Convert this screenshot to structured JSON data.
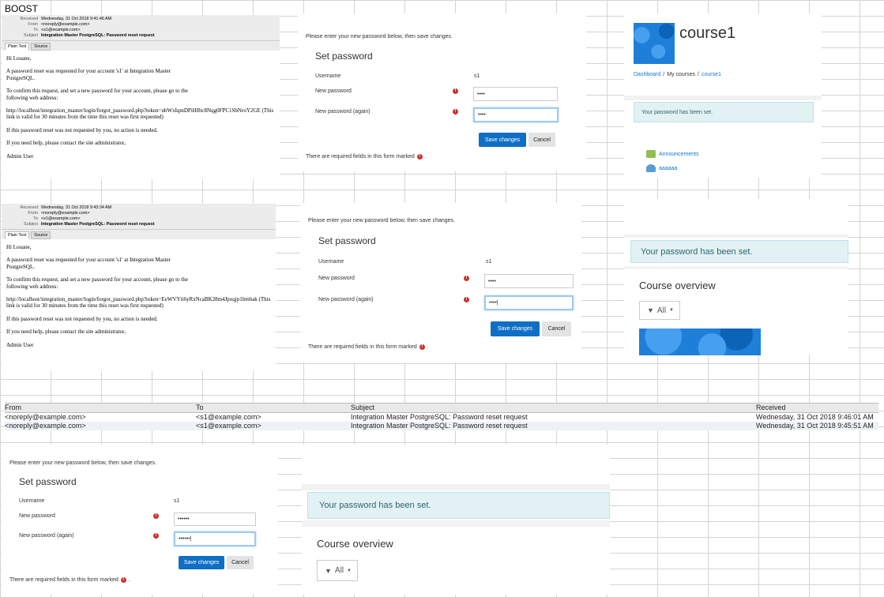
{
  "label": "BOOST",
  "email_fields": {
    "received": "Received",
    "from": "From",
    "to": "To",
    "subject": "Subject"
  },
  "email_tabs": [
    "Plain Text",
    "Source"
  ],
  "emails": [
    {
      "received": "Wednesday, 31 Oct 2018 9:41:46 AM",
      "from": "<noreply@example.com>",
      "to": "<s1@example.com>",
      "subject": "Integration Master PostgreSQL: Password reset request",
      "body": [
        "Hi Louane,",
        "A password reset was requested for your account 's1' at Integration Master PostgreSQL.",
        "To confirm this request, and set a new password for your account, please go to the following web address:",
        "http://localhost/integration_master/login/forgot_password.php?token=ubWxIqmDPiHRtc8Nqg0FPC1SbNroY2GE (This link is valid for 30 minutes from the time this reset was first requested)",
        "If this password reset was not requested by you, no action is needed.",
        "If you need help, please contact the site administrator,",
        "Admin User"
      ]
    },
    {
      "received": "Wednesday, 31 Oct 2018 9:43:34 AM",
      "from": "<noreply@example.com>",
      "to": "<s1@example.com>",
      "subject": "Integration Master PostgreSQL: Password reset request",
      "body": [
        "Hi Louane,",
        "A password reset was requested for your account 's1' at Integration Master PostgreSQL.",
        "To confirm this request, and set a new password for your account, please go to the following web address:",
        "http://localhost/integration_master/login/forgot_password.php?token=EeWVYti6yRxNcaBK28m4Jpxqjp1bmbak (This link is valid for 30 minutes from the time this reset was first requested)",
        "If this password reset was not requested by you, no action is needed.",
        "If you need help, please contact the site administrator,",
        "Admin User"
      ]
    }
  ],
  "form": {
    "intro": "Please enter your new password below, then save changes.",
    "title": "Set password",
    "username_label": "Username",
    "username_value": "s1",
    "new_password_label": "New password",
    "new_password_again_label": "New password (again)",
    "save_label": "Save changes",
    "cancel_label": "Cancel",
    "required_note": "There are required fields in this form marked",
    "required_note_end": "."
  },
  "forms": [
    {
      "pw1": "••••",
      "pw2": "••••"
    },
    {
      "pw1": "••••",
      "pw2": "••••|"
    },
    {
      "pw1": "••••••",
      "pw2": "••••••|"
    }
  ],
  "course": {
    "title": "course1",
    "breadcrumb": [
      "Dashboard",
      "My courses",
      "course1"
    ],
    "breadcrumb_sep": "/",
    "alert": "Your password has been set.",
    "activities": [
      "Announcements",
      "aaaaaa"
    ]
  },
  "dashboard": {
    "alert": "Your password has been set.",
    "overview_title": "Course overview",
    "filter_label": "All"
  },
  "mail_table": {
    "headers": [
      "From",
      "To",
      "Subject",
      "Received"
    ],
    "rows": [
      [
        "<noreply@example.com>",
        "<s1@example.com>",
        "Integration Master PostgreSQL: Password reset request",
        "Wednesday, 31 Oct 2018 9:46:01 AM"
      ],
      [
        "<noreply@example.com>",
        "<s1@example.com>",
        "Integration Master PostgreSQL: Password reset request",
        "Wednesday, 31 Oct 2018 9:45:51 AM"
      ]
    ]
  },
  "colors": {
    "primary": "#0f6fc5",
    "alert_bg": "#e2f1f4",
    "link": "#1177d1",
    "required": "#c9302c"
  }
}
